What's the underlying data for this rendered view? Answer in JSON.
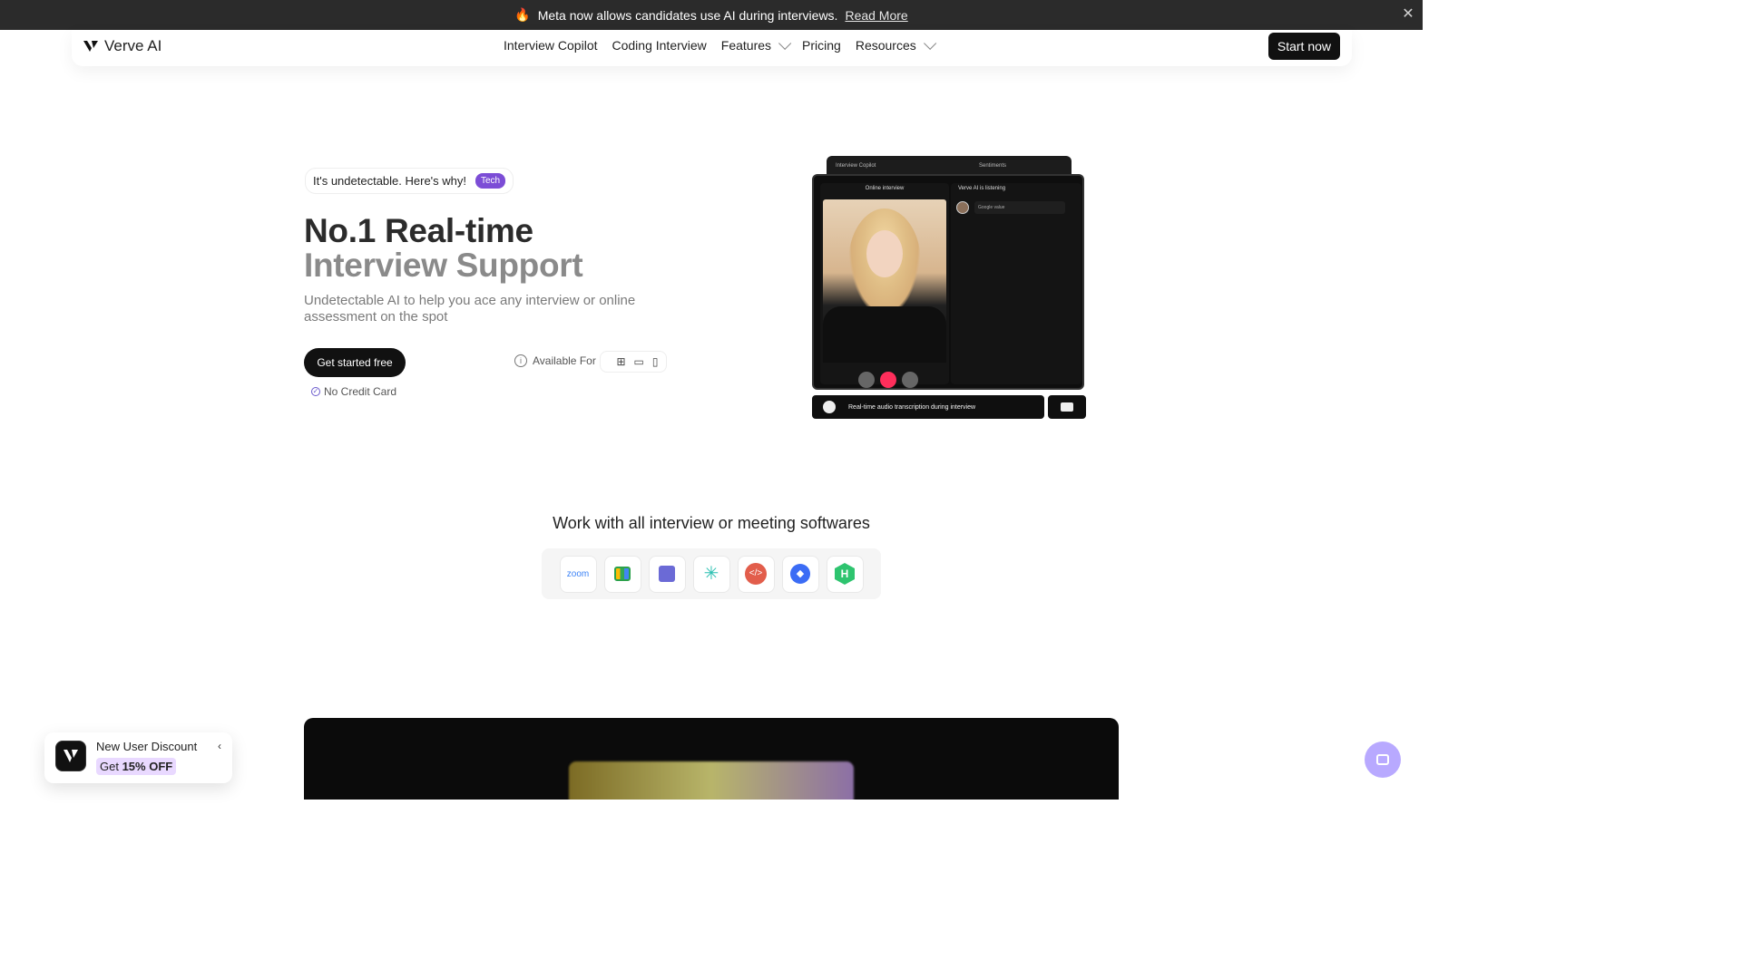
{
  "announcement": {
    "emoji": "🔥",
    "text": "Meta now allows candidates use AI during interviews.",
    "link": "Read More",
    "close_icon": "close-icon"
  },
  "nav": {
    "logo_text": "Verve AI",
    "items": [
      "Interview Copilot",
      "Coding Interview",
      "Features",
      "Pricing",
      "Resources"
    ],
    "start_button": "Start now"
  },
  "hero": {
    "badge_text": "It's undetectable. Here's why!",
    "badge_tag": "Tech",
    "title_line1": "No.1 Real-time",
    "title_line2": "Interview Support",
    "subtitle": "Undetectable AI to help you ace any interview or online assessment on the spot",
    "cta": "Get started free",
    "no_credit_card": "No Credit Card",
    "available_for": "Available For",
    "platform_icons": [
      "apple-icon",
      "windows-icon",
      "desktop-icon",
      "mobile-icon"
    ]
  },
  "preview": {
    "tab_copilot": "Interview Copilot",
    "tab_sentiments": "Sentiments",
    "online_interview": "Online interview",
    "listening": "Verve AI is listening",
    "question_text": "Google value",
    "transcription": "Real-time audio transcription during interview"
  },
  "integrations": {
    "title": "Work with all interview or meeting softwares",
    "zoom_label": "zoom"
  },
  "discount": {
    "title": "New User Discount",
    "offer_prefix": "Get ",
    "offer_bold": "15% OFF"
  }
}
